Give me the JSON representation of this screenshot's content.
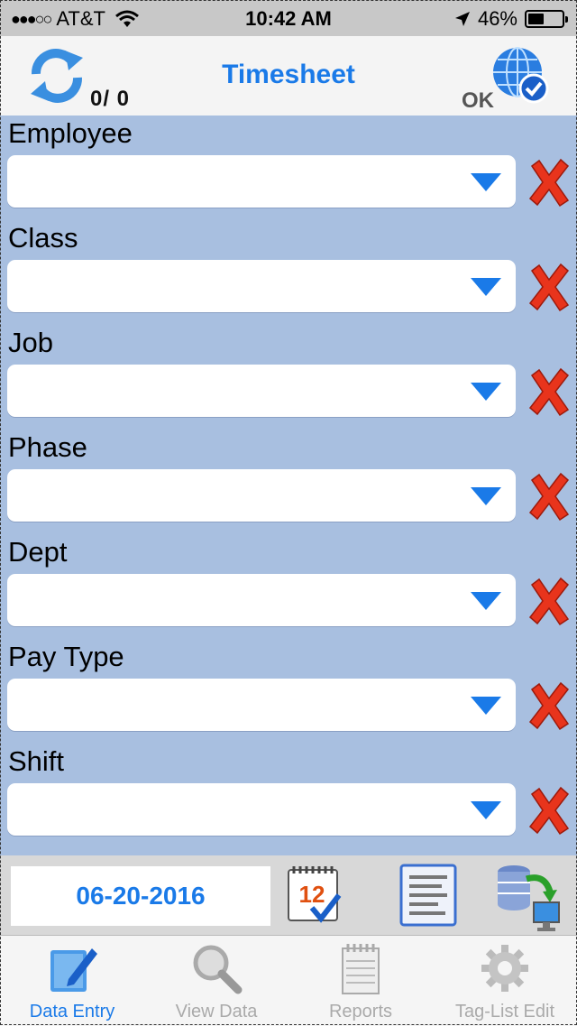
{
  "status_bar": {
    "carrier": "AT&T",
    "time": "10:42 AM",
    "battery": "46%",
    "battery_level": 0.46
  },
  "header": {
    "title": "Timesheet",
    "counter": "0/  0",
    "ok_label": "OK"
  },
  "fields": [
    {
      "label": "Employee",
      "value": ""
    },
    {
      "label": "Class",
      "value": ""
    },
    {
      "label": "Job",
      "value": ""
    },
    {
      "label": "Phase",
      "value": ""
    },
    {
      "label": "Dept",
      "value": ""
    },
    {
      "label": "Pay Type",
      "value": ""
    },
    {
      "label": "Shift",
      "value": ""
    }
  ],
  "tools": {
    "date": "06-20-2016",
    "calendar_day": "12"
  },
  "tabs": [
    {
      "label": "Data Entry",
      "icon": "edit-icon",
      "active": true
    },
    {
      "label": "View Data",
      "icon": "magnifier-icon",
      "active": false
    },
    {
      "label": "Reports",
      "icon": "notepad-icon",
      "active": false
    },
    {
      "label": "Tag-List Edit",
      "icon": "gear-icon",
      "active": false
    }
  ],
  "colors": {
    "accent": "#1a7ae8",
    "form_bg": "#a8bfe0",
    "clear_red": "#e8341c"
  }
}
